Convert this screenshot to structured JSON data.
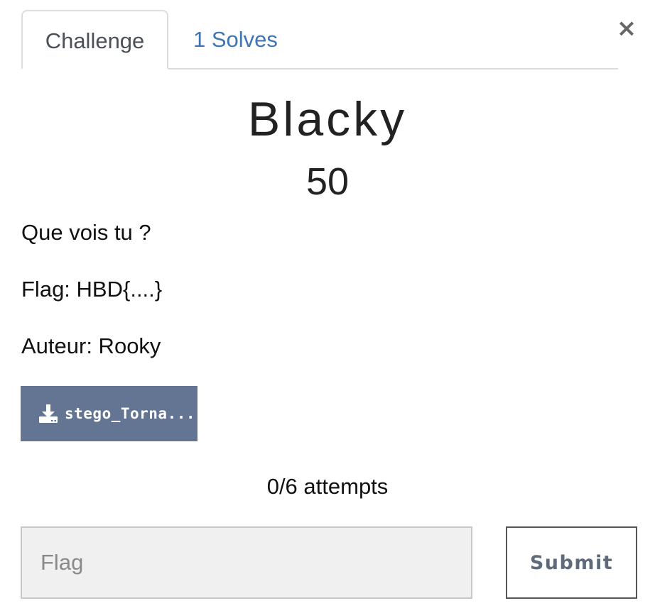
{
  "modal": {
    "close_label": "×"
  },
  "tabs": [
    {
      "label": "Challenge",
      "active": true
    },
    {
      "label": "1 Solves",
      "active": false
    }
  ],
  "challenge": {
    "name": "Blacky",
    "points": "50",
    "description": [
      "Que vois tu ?",
      "Flag: HBD{....}",
      "Auteur: Rooky"
    ],
    "file": {
      "icon": "download-icon",
      "label": "stego_Torna..."
    },
    "attempts": "0/6 attempts"
  },
  "submission": {
    "placeholder": "Flag",
    "value": "",
    "submit_label": "Submit"
  },
  "colors": {
    "tab_link": "#3f75b5",
    "file_button_bg": "#637592",
    "input_bg": "#f0f0f0",
    "submit_text": "#5f6b7a"
  }
}
